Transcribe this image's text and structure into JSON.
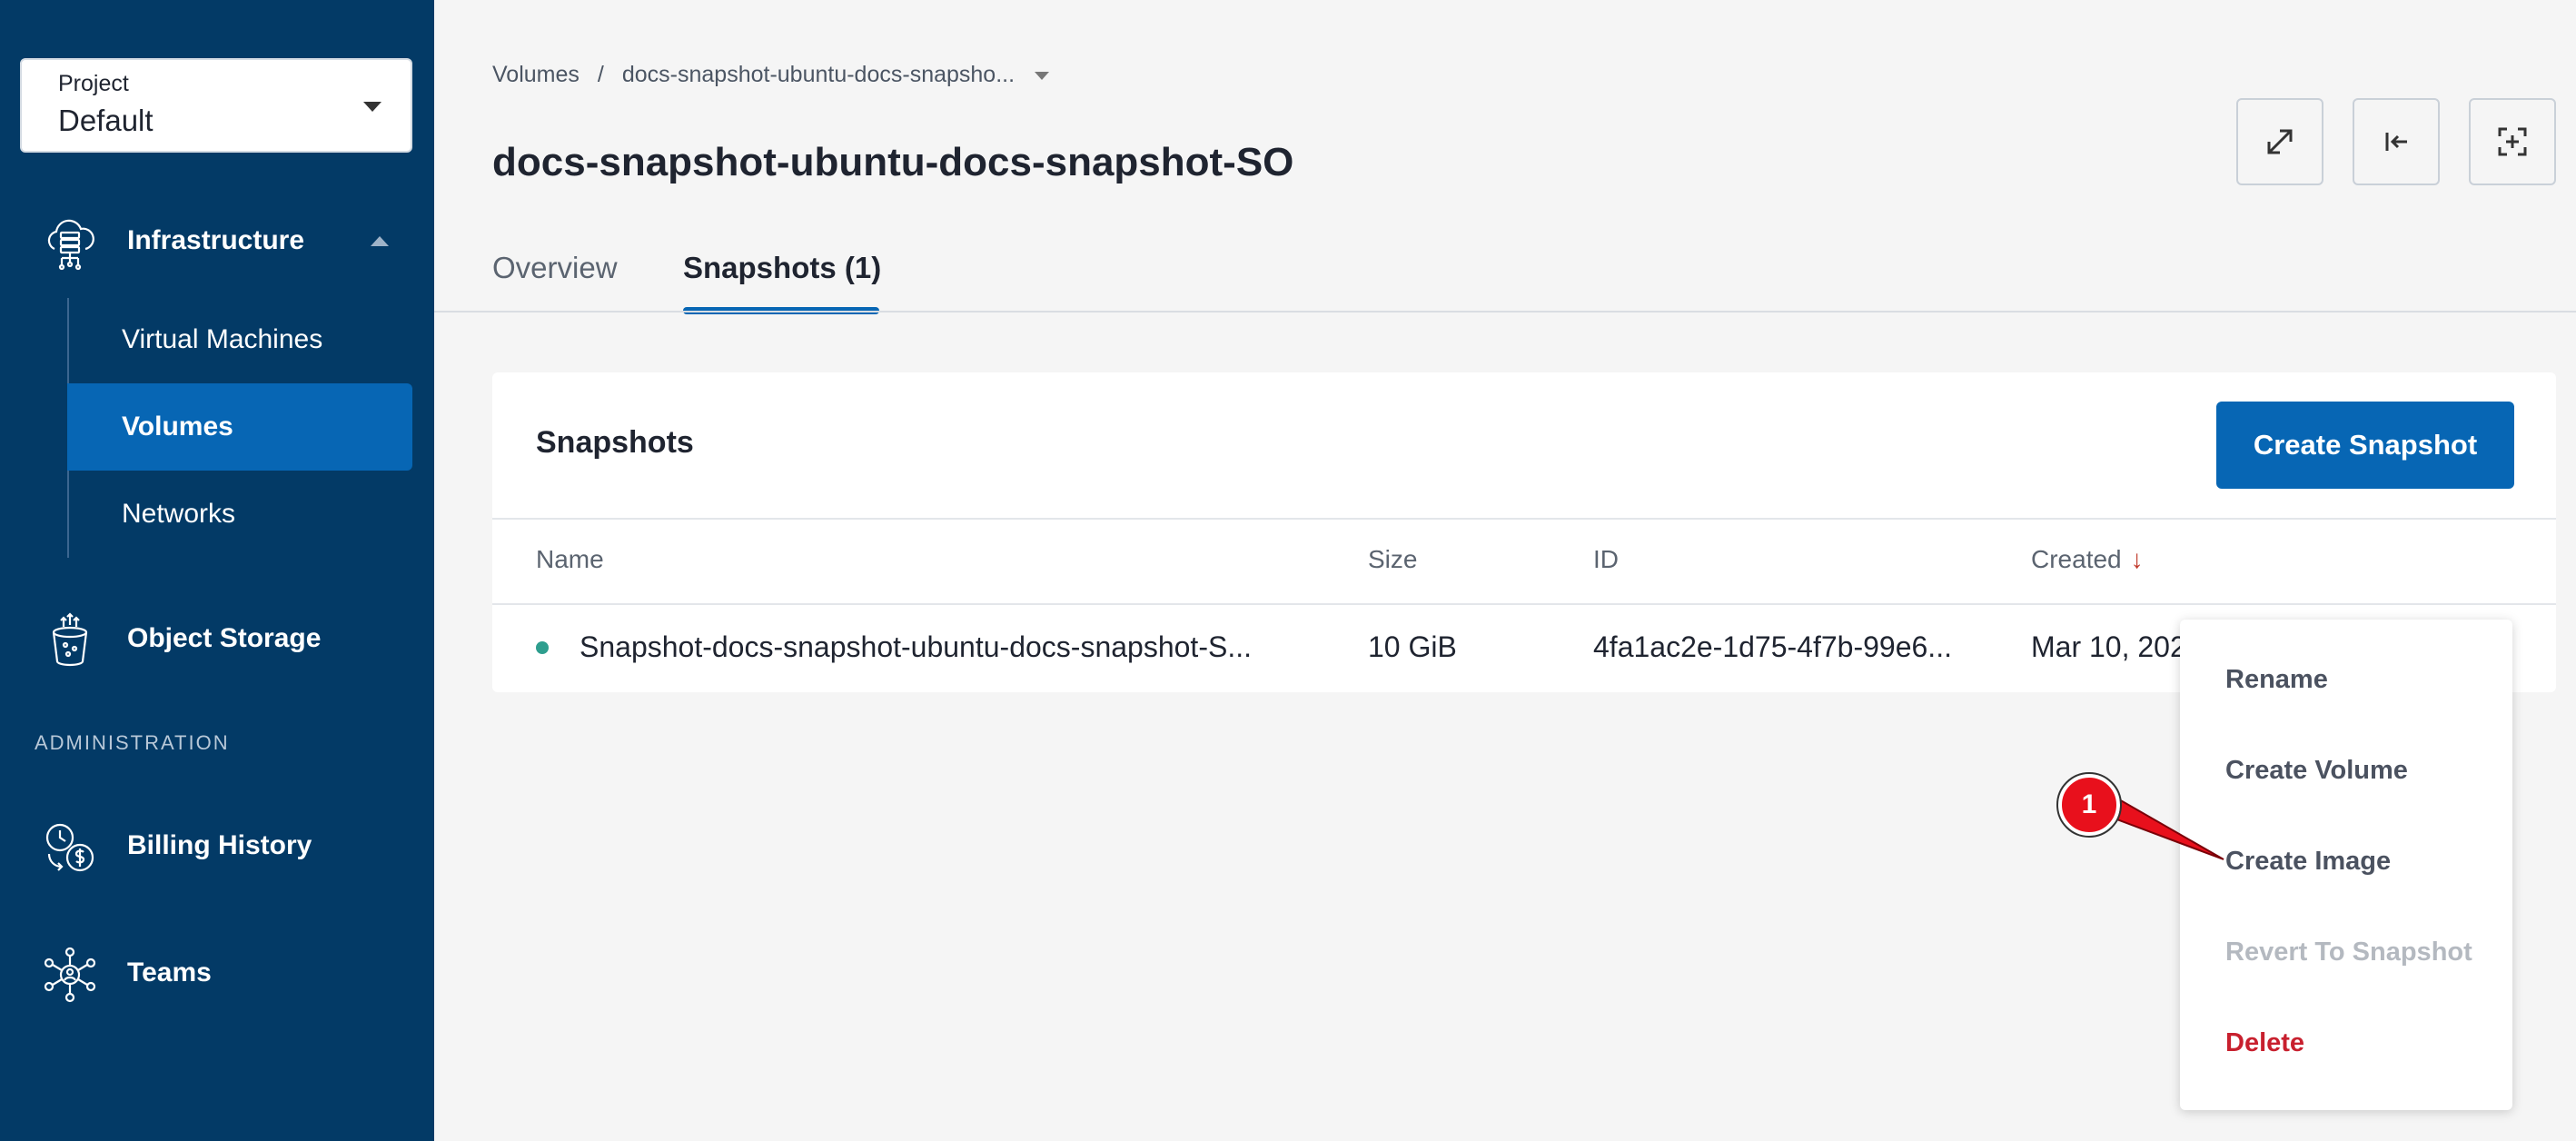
{
  "sidebar": {
    "project_label": "Project",
    "project_value": "Default",
    "infrastructure": {
      "label": "Infrastructure",
      "icon": "cloud-server-icon"
    },
    "sub_items": [
      {
        "label": "Virtual Machines"
      },
      {
        "label": "Volumes",
        "active": true
      },
      {
        "label": "Networks"
      }
    ],
    "object_storage": {
      "label": "Object Storage",
      "icon": "storage-bucket-icon"
    },
    "admin_label": "ADMINISTRATION",
    "billing": {
      "label": "Billing History",
      "icon": "billing-clock-icon"
    },
    "teams": {
      "label": "Teams",
      "icon": "team-network-icon"
    }
  },
  "breadcrumb": {
    "root": "Volumes",
    "separator": "/",
    "current": "docs-snapshot-ubuntu-docs-snapsho..."
  },
  "page_title": "docs-snapshot-ubuntu-docs-snapshot-SO",
  "tabs": [
    {
      "label": "Overview",
      "active": false
    },
    {
      "label": "Snapshots (1)",
      "active": true
    }
  ],
  "card": {
    "title": "Snapshots",
    "create_button": "Create Snapshot",
    "columns": [
      "Name",
      "Size",
      "ID",
      "Created"
    ],
    "sort_indicator": "↓",
    "row": {
      "name": "Snapshot-docs-snapshot-ubuntu-docs-snapshot-S...",
      "size": "10 GiB",
      "id": "4fa1ac2e-1d75-4f7b-99e6...",
      "created": "Mar 10, 202"
    }
  },
  "context_menu": {
    "items": [
      {
        "label": "Rename"
      },
      {
        "label": "Create Volume"
      },
      {
        "label": "Create Image"
      },
      {
        "label": "Revert To Snapshot",
        "disabled": true
      },
      {
        "label": "Delete",
        "danger": true
      }
    ]
  },
  "callout": {
    "number": "1"
  },
  "colors": {
    "sidebar_bg": "#033a66",
    "accent": "#0766b4",
    "danger": "#c8202e",
    "status_ok": "#2e9e8e",
    "callout_red": "#e8101c"
  }
}
